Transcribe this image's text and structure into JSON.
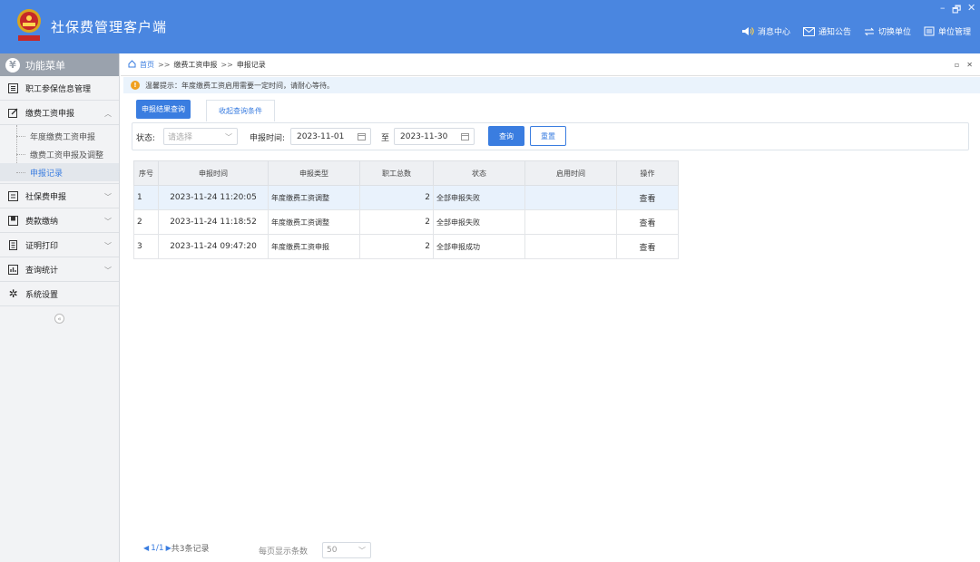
{
  "app": {
    "title": "社保费管理客户端",
    "window_controls": [
      "–",
      "🗗",
      "✕"
    ]
  },
  "header_actions": [
    {
      "icon": "speaker-icon",
      "label": "消息中心"
    },
    {
      "icon": "mail-icon",
      "label": "通知公告"
    },
    {
      "icon": "switch-arrows-icon",
      "label": "切换单位"
    },
    {
      "icon": "building-icon",
      "label": "单位管理"
    }
  ],
  "sidebar": {
    "title": "功能菜单",
    "items": [
      {
        "label": "职工参保信息管理",
        "icon": "list-icon"
      },
      {
        "label": "缴费工资申报",
        "icon": "edit-icon",
        "expanded": true,
        "children": [
          "年度缴费工资申报",
          "缴费工资申报及调整",
          "申报记录"
        ]
      },
      {
        "label": "社保费申报",
        "icon": "form-icon"
      },
      {
        "label": "费款缴纳",
        "icon": "wallet-icon"
      },
      {
        "label": "证明打印",
        "icon": "print-icon"
      },
      {
        "label": "查询统计",
        "icon": "chart-icon"
      },
      {
        "label": "系统设置",
        "icon": "gear-icon"
      }
    ],
    "active_child": "申报记录"
  },
  "breadcrumb": {
    "home": "首页",
    "sep1": ">>",
    "level1": "缴费工资申报",
    "sep2": ">>",
    "level2": "申报记录"
  },
  "notice": "温馨提示：年度缴费工资启用需要一定时间，请耐心等待。",
  "tabs": {
    "active": "申报结果查询",
    "secondary": "收起查询条件"
  },
  "filters": {
    "status_label": "状态:",
    "status_placeholder": "请选择",
    "date_label": "申报时间:",
    "date_from": "2023-11-01",
    "date_to_label": "至",
    "date_to": "2023-11-30",
    "query_button": "查询",
    "reset_button": "重置"
  },
  "table": {
    "headers": [
      "序号",
      "申报时间",
      "申报类型",
      "职工总数",
      "状态",
      "启用时间",
      "操作"
    ],
    "rows": [
      {
        "no": "1",
        "time": "2023-11-24 11:20:05",
        "type": "年度缴费工资调整",
        "count": "2",
        "status": "全部申报失败",
        "enabled": "",
        "action": "查看"
      },
      {
        "no": "2",
        "time": "2023-11-24 11:18:52",
        "type": "年度缴费工资调整",
        "count": "2",
        "status": "全部申报失败",
        "enabled": "",
        "action": "查看"
      },
      {
        "no": "3",
        "time": "2023-11-24 09:47:20",
        "type": "年度缴费工资申报",
        "count": "2",
        "status": "全部申报成功",
        "enabled": "",
        "action": "查看"
      }
    ]
  },
  "pager": {
    "page": "1/1",
    "total": "共3条记录",
    "size_label": "每页显示条数",
    "size_value": "50"
  },
  "colors": {
    "brand": "#4a86e0",
    "accent": "#3a7de0",
    "warn": "#f0a020"
  }
}
